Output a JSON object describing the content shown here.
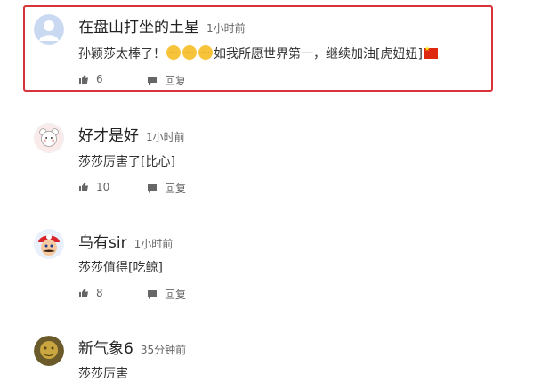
{
  "comments": [
    {
      "user": "在盘山打坐的土星",
      "time": "1小时前",
      "text_before": "孙颖莎太棒了！",
      "text_after": "如我所愿世界第一，继续加油[虎妞妞]",
      "emojis": [
        "smile-emoji",
        "smile-emoji",
        "smile-emoji"
      ],
      "flag": "china-flag",
      "likes": "6",
      "reply": "回复",
      "highlighted": true,
      "avatar": "default-avatar"
    },
    {
      "user": "好才是好",
      "time": "1小时前",
      "text": "莎莎厉害了[比心]",
      "likes": "10",
      "reply": "回复",
      "avatar": "cartoon-bear-avatar"
    },
    {
      "user": "乌有sir",
      "time": "1小时前",
      "text": "莎莎值得[吃鲸]",
      "likes": "8",
      "reply": "回复",
      "avatar": "mario-avatar"
    },
    {
      "user": "新气象6",
      "time": "35分钟前",
      "text": "莎莎厉害",
      "avatar": "golden-statue-avatar"
    }
  ],
  "colors": {
    "highlight_border": "#d9333a",
    "meta_gray": "#666666"
  }
}
